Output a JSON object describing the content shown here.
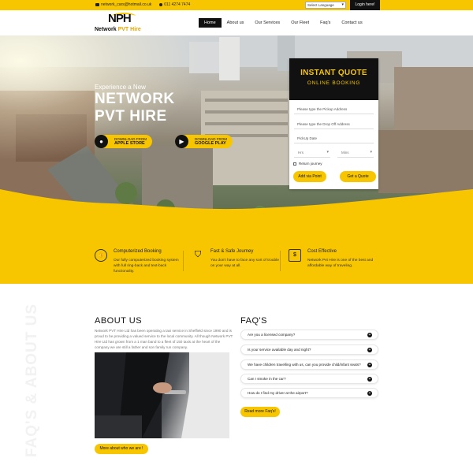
{
  "topbar": {
    "email": "network_cars@hotmail.co.uk",
    "phone": "011 4274 7474",
    "language": "Select Language",
    "login": "Login here!"
  },
  "logo": {
    "mark": "NPH",
    "name_a": "Network",
    "name_b": "PVT Hire"
  },
  "nav": [
    "Home",
    "About us",
    "Our Services",
    "Our Fleet",
    "Faq's",
    "Contact us"
  ],
  "hero": {
    "subtitle": "Experience a New",
    "title_1": "NETWORK",
    "title_2": "PVT HIRE",
    "apple": {
      "small": "DOWNLOAD FROM",
      "big": "APPLE STORE"
    },
    "google": {
      "small": "DOWNLOAD FROM",
      "big": "GOOGLE PLAY"
    }
  },
  "quote": {
    "title": "INSTANT QUOTE",
    "subtitle": "ONLINE BOOKING",
    "pickup_placeholder": "Please type the Pickup Address",
    "dropoff_placeholder": "Please type the Drop Off Address",
    "pickup_date": "PickUp Date",
    "hrs": "Hrs",
    "mins": "Mins",
    "return": "Return journey",
    "via_btn": "Add via Point",
    "quote_btn": "Get a Quote"
  },
  "features": [
    {
      "title": "Computerized Booking",
      "desc": "Our fully computerized booking system with full ring-back and text-back functionality."
    },
    {
      "title": "Fast & Safe Journey",
      "desc": "You don't have to face any sort of trouble on your way at all."
    },
    {
      "title": "Cost Effective",
      "desc": "Network Pvt Hire is one of the best and affordable way of traveling."
    }
  ],
  "side_text": "FAQ'S & ABOUT US",
  "about": {
    "heading": "ABOUT US",
    "text": "Network PVT Hire Ltd has been operating a taxi service in Sheffield since 1990 and is proud to be providing a valued service to the local community. All though Network PVT Hire Ltd has grown from a 1 man band to a fleet of 150 taxis at the heart of the company we are still a father and son family run company.",
    "button": "More about who we are !"
  },
  "faq": {
    "heading": "FAQ'S",
    "items": [
      "Are you a licensed company?",
      "Is your service available day and night?",
      "We have children travelling with us, can you provide child/infant seats?",
      "Can I smoke in the car?",
      "How do I find my driver at the airport?"
    ],
    "button": "Read more Faq's!"
  },
  "colors": {
    "accent": "#f7c600",
    "dark": "#111111"
  }
}
